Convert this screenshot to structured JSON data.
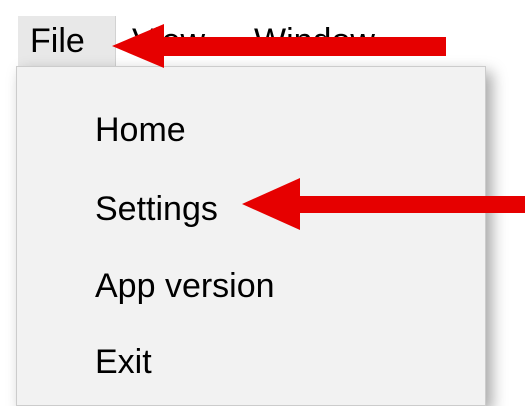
{
  "menubar": {
    "file_label": "File",
    "view_label": "View",
    "window_label": "Window"
  },
  "dropdown": {
    "items": [
      {
        "label": "Home"
      },
      {
        "label": "Settings"
      },
      {
        "label": "App version"
      },
      {
        "label": "Exit"
      }
    ]
  },
  "annotations": {
    "arrow_color": "#e60000",
    "arrow_icon": "left-arrow-icon"
  }
}
